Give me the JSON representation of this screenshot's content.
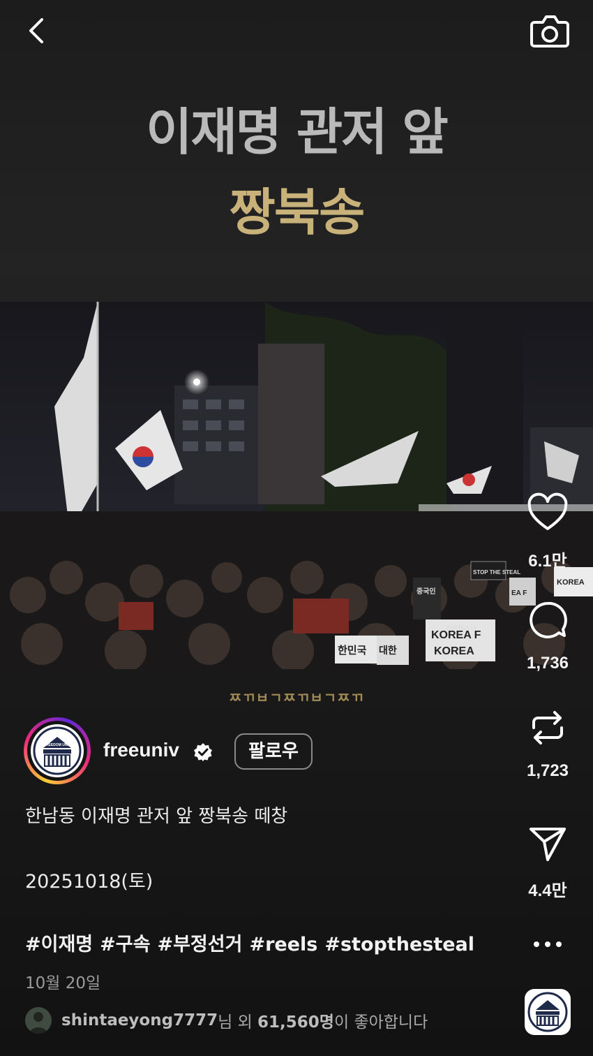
{
  "header": {
    "back_icon": "chevron-left-icon",
    "camera_icon": "camera-icon"
  },
  "video": {
    "headline_line1": "이재명 관저 앞",
    "headline_line2": "짱북송",
    "subtitle": "ㅉㄲㅂㄱㅉㄲㅂㄱㅉㄲ",
    "sign_text": [
      "STOP THE STEAL",
      "KOREA F",
      "KOREA",
      "한민국",
      "대한",
      "중국인",
      "EA F",
      "KOREA FI",
      "KOREA"
    ]
  },
  "actions": {
    "like_count": "6.1만",
    "comment_count": "1,736",
    "repost_count": "1,723",
    "share_count": "4.4만"
  },
  "account": {
    "username": "freeuniv",
    "verified": true,
    "follow_label": "팔로우",
    "logo_text": "FREEDOM UNIV"
  },
  "post": {
    "caption_line1": "한남동 이재명 관저 앞 짱북송 떼창",
    "caption_line2": "20251018(토)",
    "hashtags": [
      "#이재명",
      "#구속",
      "#부정선거",
      "#reels",
      "#stopthesteal"
    ],
    "date": "10월 20일"
  },
  "likes": {
    "liker": "shintaeyong7777",
    "mid_text": "님 외 ",
    "count": "61,560명",
    "tail_text": "이 좋아합니다"
  },
  "colors": {
    "background": "#141414",
    "headline_gray": "#b9b9b9",
    "headline_gold": "#c9b27a",
    "verified_badge": "#ffffff"
  }
}
